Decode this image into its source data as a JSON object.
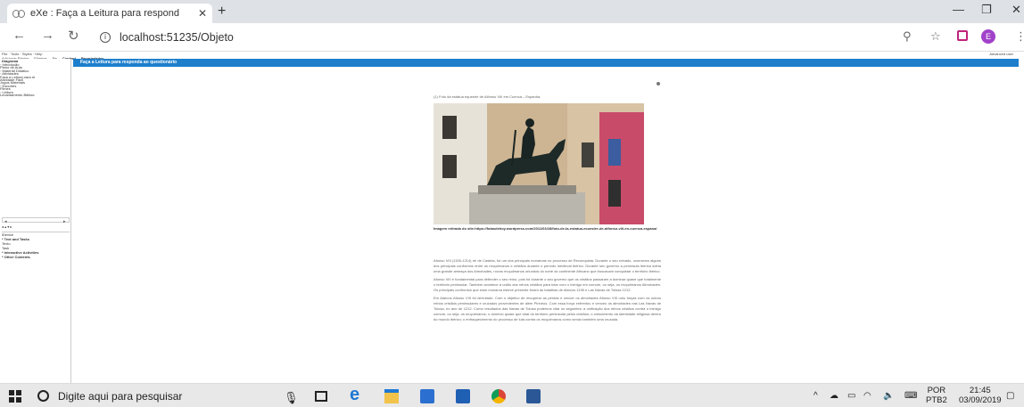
{
  "browser": {
    "tab_title": "eXe : Faça a Leitura para respond",
    "tab_close": "✕",
    "new_tab": "+",
    "url": "localhost:51235/Objeto",
    "info": "i"
  },
  "app": {
    "menu": "File · Tools · Styles · Help",
    "left_tabs": [
      "Adicionar Página",
      "Eliminar",
      "Re"
    ],
    "tabs": [
      "Content",
      "Propriedades"
    ],
    "advanced": "Advanced user",
    "outline_title": "Diagrama",
    "outline": [
      "◦ Introdução",
      "   Plano de Aula",
      "◦ Material Didático",
      "   ◦ Atividades",
      "      Faça a Leitura para re",
      "      Atividade Fácil",
      "      Jogos Materiais",
      "◦ Esportes",
      "   Filmes",
      "◦ Leitura",
      "      Levantamento Bibliog"
    ],
    "left_arrows": "◂ ▴ ▾ ▸",
    "idevices_header": "iDevice",
    "idevices": [
      {
        "label": "* Text and Tasks",
        "bold": true
      },
      {
        "label": "Texto",
        "bold": false
      },
      {
        "label": "Task",
        "bold": false
      },
      {
        "label": "* Interactive Activities",
        "bold": true
      },
      {
        "label": "* Other Contents",
        "bold": true
      }
    ],
    "page_title": "Faça a Leitura para responda ao questionário",
    "caption": "(1) Foto da estátua equestre de Alfonso VIII em Cuenca – Espanha.",
    "credit": "Imagem retirada do site:https://fotasdehoy.wordpress.com/2011/03/28/foto-de-la-estatua-ecuestre-de-alfonso-viii-en-cuenca-espana/",
    "paragraphs": [
      "Afonso VIII (1155-1214) rei de Castela, foi um dos principais monarcas no processo de Reconquista. Durante o seu reinado, ocorreram alguns dos principais confrontos entre os muçulmanos e cristãos durante o período medieval ibérico. Durante seu governo a península ibérica sofria uma grande ameaça dos Almohades, novos muçulmanos oriundos do norte do continente Africano que buscavam conquistar o território ibérico.",
      "Afonso VIII é fundamental para defender o seu reino, pois foi durante o seu governo que os cristãos passaram a dominar quase que totalmente o território peninsular. Também acontece a união dos reinos cristãos para lutar com o inimigo em comum, ou seja, os muçulmanos Almohades. Os principais confrontos que esse monarca esteve presente foram as batalhas de Alarcos 1195 e Las Navas de Tolosa 1212.",
      "Em Alarcos Afonso VIII foi derrotado. Com o objetivo de recuperar as perdas e vencer os almohades Afonso VIII uniu forças com os outros reinos cristãos peninsulares e cruzados provenientes de além Pirineus. Com essa força enfrentou e venceu os almohades nas Las Navas de Tolosa, no ano de 1212. Como resultados das Navas de Tolosa podemos citar os seguintes: a unificação dos reinos cristãos contra o inimigo comum, ou seja, os muçulmanos; o domínio quase que total do território peninsular pelos cristãos; o crescimento da identidade religiosa dentro do mundo ibérico; o enfraquecimento do processo de luta contra os muçulmanos como sendo também uma cruzada."
    ]
  },
  "taskbar": {
    "search_placeholder": "Digite aqui para pesquisar",
    "lang_top": "POR",
    "lang_bottom": "PTB2",
    "time": "21:45",
    "date": "03/09/2019"
  },
  "colors": {
    "header_blue": "#1d7fcc",
    "avatar": "#a142c9"
  },
  "icons": [
    "back-arrow-icon",
    "forward-arrow-icon",
    "reload-icon",
    "zoom-icon",
    "star-icon",
    "extension-icon",
    "menu-dots-icon"
  ]
}
